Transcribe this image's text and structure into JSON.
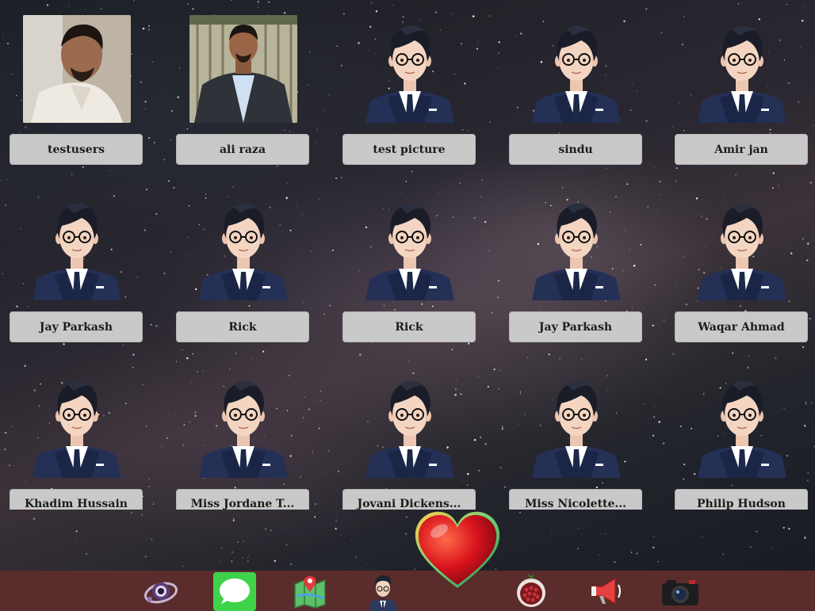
{
  "contacts": [
    {
      "name": "testusers",
      "avatar": "photo-1"
    },
    {
      "name": "ali raza",
      "avatar": "photo-2"
    },
    {
      "name": "test picture",
      "avatar": "default"
    },
    {
      "name": "sindu",
      "avatar": "default"
    },
    {
      "name": "Amir jan",
      "avatar": "default"
    },
    {
      "name": "Jay Parkash",
      "avatar": "default"
    },
    {
      "name": "Rick",
      "avatar": "default"
    },
    {
      "name": "Rick",
      "avatar": "default"
    },
    {
      "name": "Jay Parkash",
      "avatar": "default"
    },
    {
      "name": "Waqar Ahmad",
      "avatar": "default"
    },
    {
      "name": "Khadim Hussain",
      "avatar": "default"
    },
    {
      "name": "Miss Jordane T...",
      "avatar": "default"
    },
    {
      "name": "Jovani Dickens...",
      "avatar": "default"
    },
    {
      "name": "Miss Nicolette...",
      "avatar": "default"
    },
    {
      "name": "Philip Hudson",
      "avatar": "default"
    }
  ],
  "dock": [
    {
      "name": "eye-orbit-icon"
    },
    {
      "name": "messages-icon"
    },
    {
      "name": "maps-icon"
    },
    {
      "name": "profile-avatar-icon"
    },
    {
      "name": "heart-icon"
    },
    {
      "name": "pomegranate-icon"
    },
    {
      "name": "megaphone-icon"
    },
    {
      "name": "camera-icon"
    }
  ],
  "colors": {
    "dock": "#5a2c2c",
    "button": "#c9c9c9",
    "messages_green": "#3fd34b",
    "heart_red": "#d8131c"
  }
}
